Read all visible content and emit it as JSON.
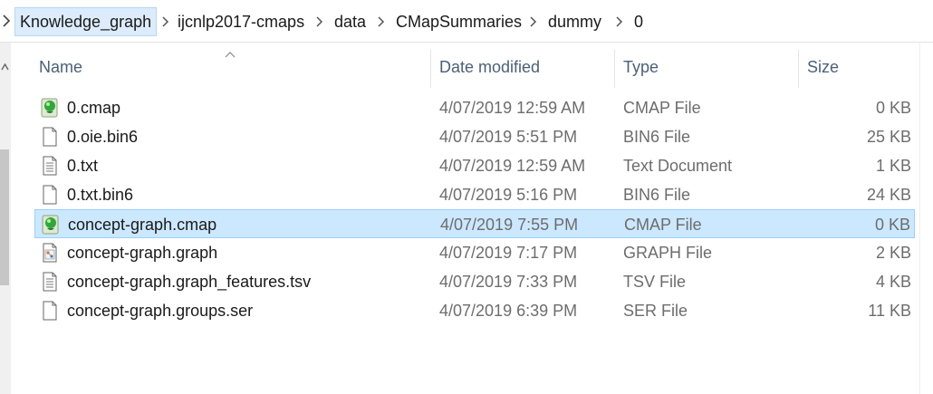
{
  "breadcrumb": [
    "Knowledge_graph",
    "ijcnlp2017-cmaps",
    "data",
    "CMapSummaries",
    "dummy",
    "0"
  ],
  "columns": {
    "name": "Name",
    "date": "Date modified",
    "type": "Type",
    "size": "Size"
  },
  "files": [
    {
      "name": "0.cmap",
      "date": "4/07/2019 12:59 AM",
      "type": "CMAP File",
      "size": "0 KB",
      "icon": "cmap-file-icon"
    },
    {
      "name": "0.oie.bin6",
      "date": "4/07/2019 5:51 PM",
      "type": "BIN6 File",
      "size": "25 KB",
      "icon": "blank-file-icon"
    },
    {
      "name": "0.txt",
      "date": "4/07/2019 12:59 AM",
      "type": "Text Document",
      "size": "1 KB",
      "icon": "text-file-icon"
    },
    {
      "name": "0.txt.bin6",
      "date": "4/07/2019 5:16 PM",
      "type": "BIN6 File",
      "size": "24 KB",
      "icon": "blank-file-icon"
    },
    {
      "name": "concept-graph.cmap",
      "date": "4/07/2019 7:55 PM",
      "type": "CMAP File",
      "size": "0 KB",
      "icon": "cmap-file-icon",
      "selected": true
    },
    {
      "name": "concept-graph.graph",
      "date": "4/07/2019 7:17 PM",
      "type": "GRAPH File",
      "size": "2 KB",
      "icon": "graph-file-icon"
    },
    {
      "name": "concept-graph.graph_features.tsv",
      "date": "4/07/2019 7:33 PM",
      "type": "TSV File",
      "size": "4 KB",
      "icon": "text-file-icon"
    },
    {
      "name": "concept-graph.groups.ser",
      "date": "4/07/2019 6:39 PM",
      "type": "SER File",
      "size": "11 KB",
      "icon": "blank-file-icon"
    }
  ],
  "colors": {
    "selection_bg": "#cce8ff",
    "selection_border": "#99d1ff",
    "breadcrumb_selected_bg": "#dcecfc",
    "header_text": "#4c607a"
  }
}
